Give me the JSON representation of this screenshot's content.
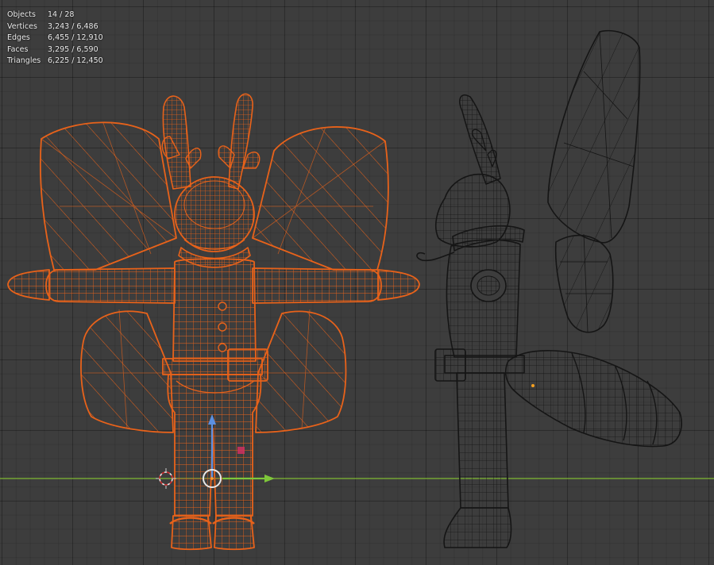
{
  "statistics": [
    {
      "label": "Objects",
      "value": "14 / 28"
    },
    {
      "label": "Vertices",
      "value": "3,243 / 6,486"
    },
    {
      "label": "Edges",
      "value": "6,455 / 12,910"
    },
    {
      "label": "Faces",
      "value": "3,295 / 6,590"
    },
    {
      "label": "Triangles",
      "value": "6,225 / 12,450"
    }
  ],
  "colors": {
    "background": "#3d3d3d",
    "selected_wire": "#e8621a",
    "unselected_wire": "#151515",
    "x_axis": "#7fb833",
    "gizmo_z": "#5b8fe0",
    "gizmo_x": "#7ec63a"
  }
}
